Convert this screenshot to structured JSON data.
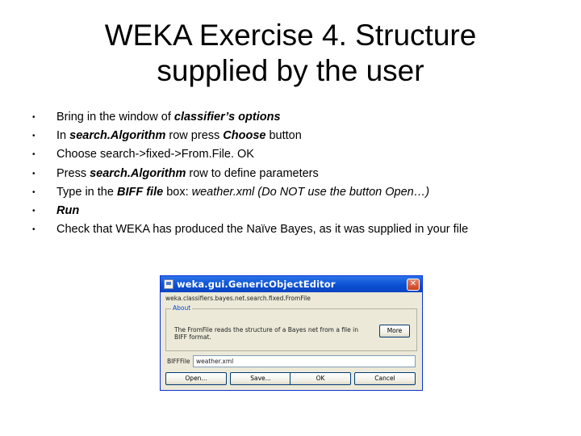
{
  "slide": {
    "title_line1": "WEKA Exercise 4. Structure",
    "title_line2": "supplied by the user",
    "bullet_char": "•",
    "bullets": [
      {
        "parts": [
          "Bring in the window of ",
          "classifier’s options"
        ]
      },
      {
        "parts": [
          "In ",
          "search.Algorithm",
          " row press ",
          "Choose",
          " button"
        ]
      },
      {
        "parts": [
          "Choose search->fixed->From.File. OK"
        ]
      },
      {
        "parts": [
          "Press ",
          "search.Algorithm",
          " row to define parameters"
        ]
      },
      {
        "parts": [
          "Type in the ",
          "BIFF file",
          " box: ",
          "weather.xml (Do NOT use the button Open…)"
        ]
      },
      {
        "parts": [
          "Run"
        ]
      },
      {
        "parts": [
          "Check that WEKA has produced the Naïve Bayes, as it was supplied in your file"
        ]
      }
    ]
  },
  "dialog": {
    "title": "weka.gui.GenericObjectEditor",
    "close_glyph": "✕",
    "classpath": "weka.classifiers.bayes.net.search.fixed.FromFile",
    "about_label": "About",
    "about_text": "The FromFile reads the structure of a Bayes net from a file in BIFF format.",
    "more_label": "More",
    "biff_label": "BIFFFile",
    "biff_value": "weather.xml",
    "buttons": {
      "open": "Open...",
      "save": "Save...",
      "ok": "OK",
      "cancel": "Cancel"
    },
    "colors": {
      "titlebar": "#0a4ed1",
      "panel": "#ece9d8",
      "about_label": "#0046d5"
    }
  }
}
